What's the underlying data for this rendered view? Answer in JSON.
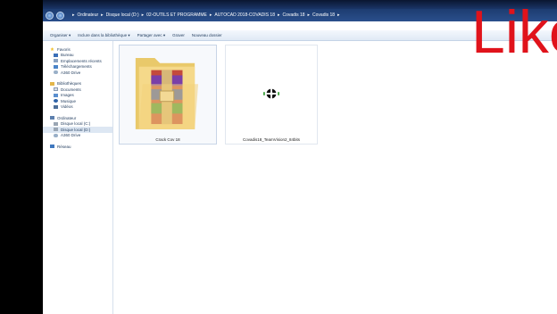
{
  "address": {
    "crumbs": [
      "Ordinateur",
      "Disque local (D:)",
      "02-OUTILS ET PROGRAMME",
      "AUTOCAD 2018-COVADIS 18",
      "Covadis 18",
      "Covadis 18"
    ]
  },
  "toolbar": {
    "organize": "Organiser ▾",
    "include": "Inclure dans la bibliothèque ▾",
    "share": "Partager avec ▾",
    "burn": "Graver",
    "new_folder": "Nouveau dossier"
  },
  "sidebar": {
    "favorites": {
      "label": "Favoris",
      "items": [
        "Bureau",
        "Emplacements récents",
        "Téléchargements",
        "A360 Drive"
      ]
    },
    "libraries": {
      "label": "Bibliothèques",
      "items": [
        "Documents",
        "Images",
        "Musique",
        "Vidéos"
      ]
    },
    "computer": {
      "label": "Ordinateur",
      "items": [
        "Disque local (C:)",
        "Disque local (D:)",
        "A360 Drive"
      ]
    },
    "network": {
      "label": "Réseau"
    }
  },
  "files": [
    {
      "name": "Crack Cov 18",
      "icon": "winrar-archive-icon"
    },
    {
      "name": "Covadis18_TeamVision2_84bits",
      "icon": "setup-file-icon"
    }
  ],
  "overlay": {
    "text": "Like"
  },
  "colors": {
    "overlay": "#e0131b",
    "addressbar": "#1d3c70"
  }
}
